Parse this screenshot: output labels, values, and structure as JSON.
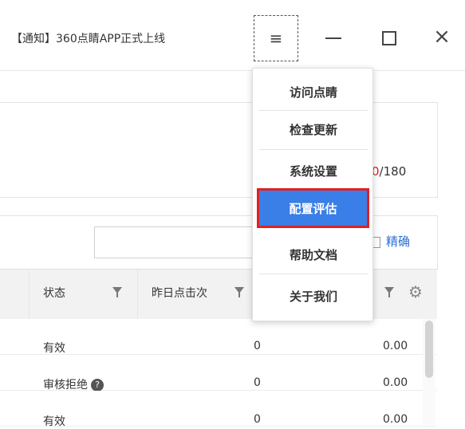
{
  "titlebar": {
    "notice": "【通知】360点睛APP正式上线",
    "menu_icon": "hamburger-icon",
    "minimize_icon": "minimize-icon",
    "maximize_icon": "maximize-icon",
    "close_icon": "close-icon"
  },
  "menu": {
    "items": [
      {
        "label": "访问点睛"
      },
      {
        "label": "检查更新"
      },
      {
        "label": "系统设置"
      },
      {
        "label": "配置评估"
      },
      {
        "label": "帮助文档"
      },
      {
        "label": "关于我们"
      }
    ],
    "highlighted_index": 3,
    "highlight_color": "#3a7ee8",
    "highlight_border": "#e02020"
  },
  "editor": {
    "counter_current": "0",
    "counter_max": "/180"
  },
  "search": {
    "placeholder": "",
    "precise_label": "精确"
  },
  "table": {
    "headers": [
      "状态",
      "昨日点击次"
    ],
    "rows": [
      {
        "status": "有效",
        "clicks": "0",
        "cost": "0.00",
        "help": false
      },
      {
        "status": "审核拒绝",
        "clicks": "0",
        "cost": "0.00",
        "help": true
      },
      {
        "status": "有效",
        "clicks": "0",
        "cost": "0.00",
        "help": false
      }
    ]
  }
}
